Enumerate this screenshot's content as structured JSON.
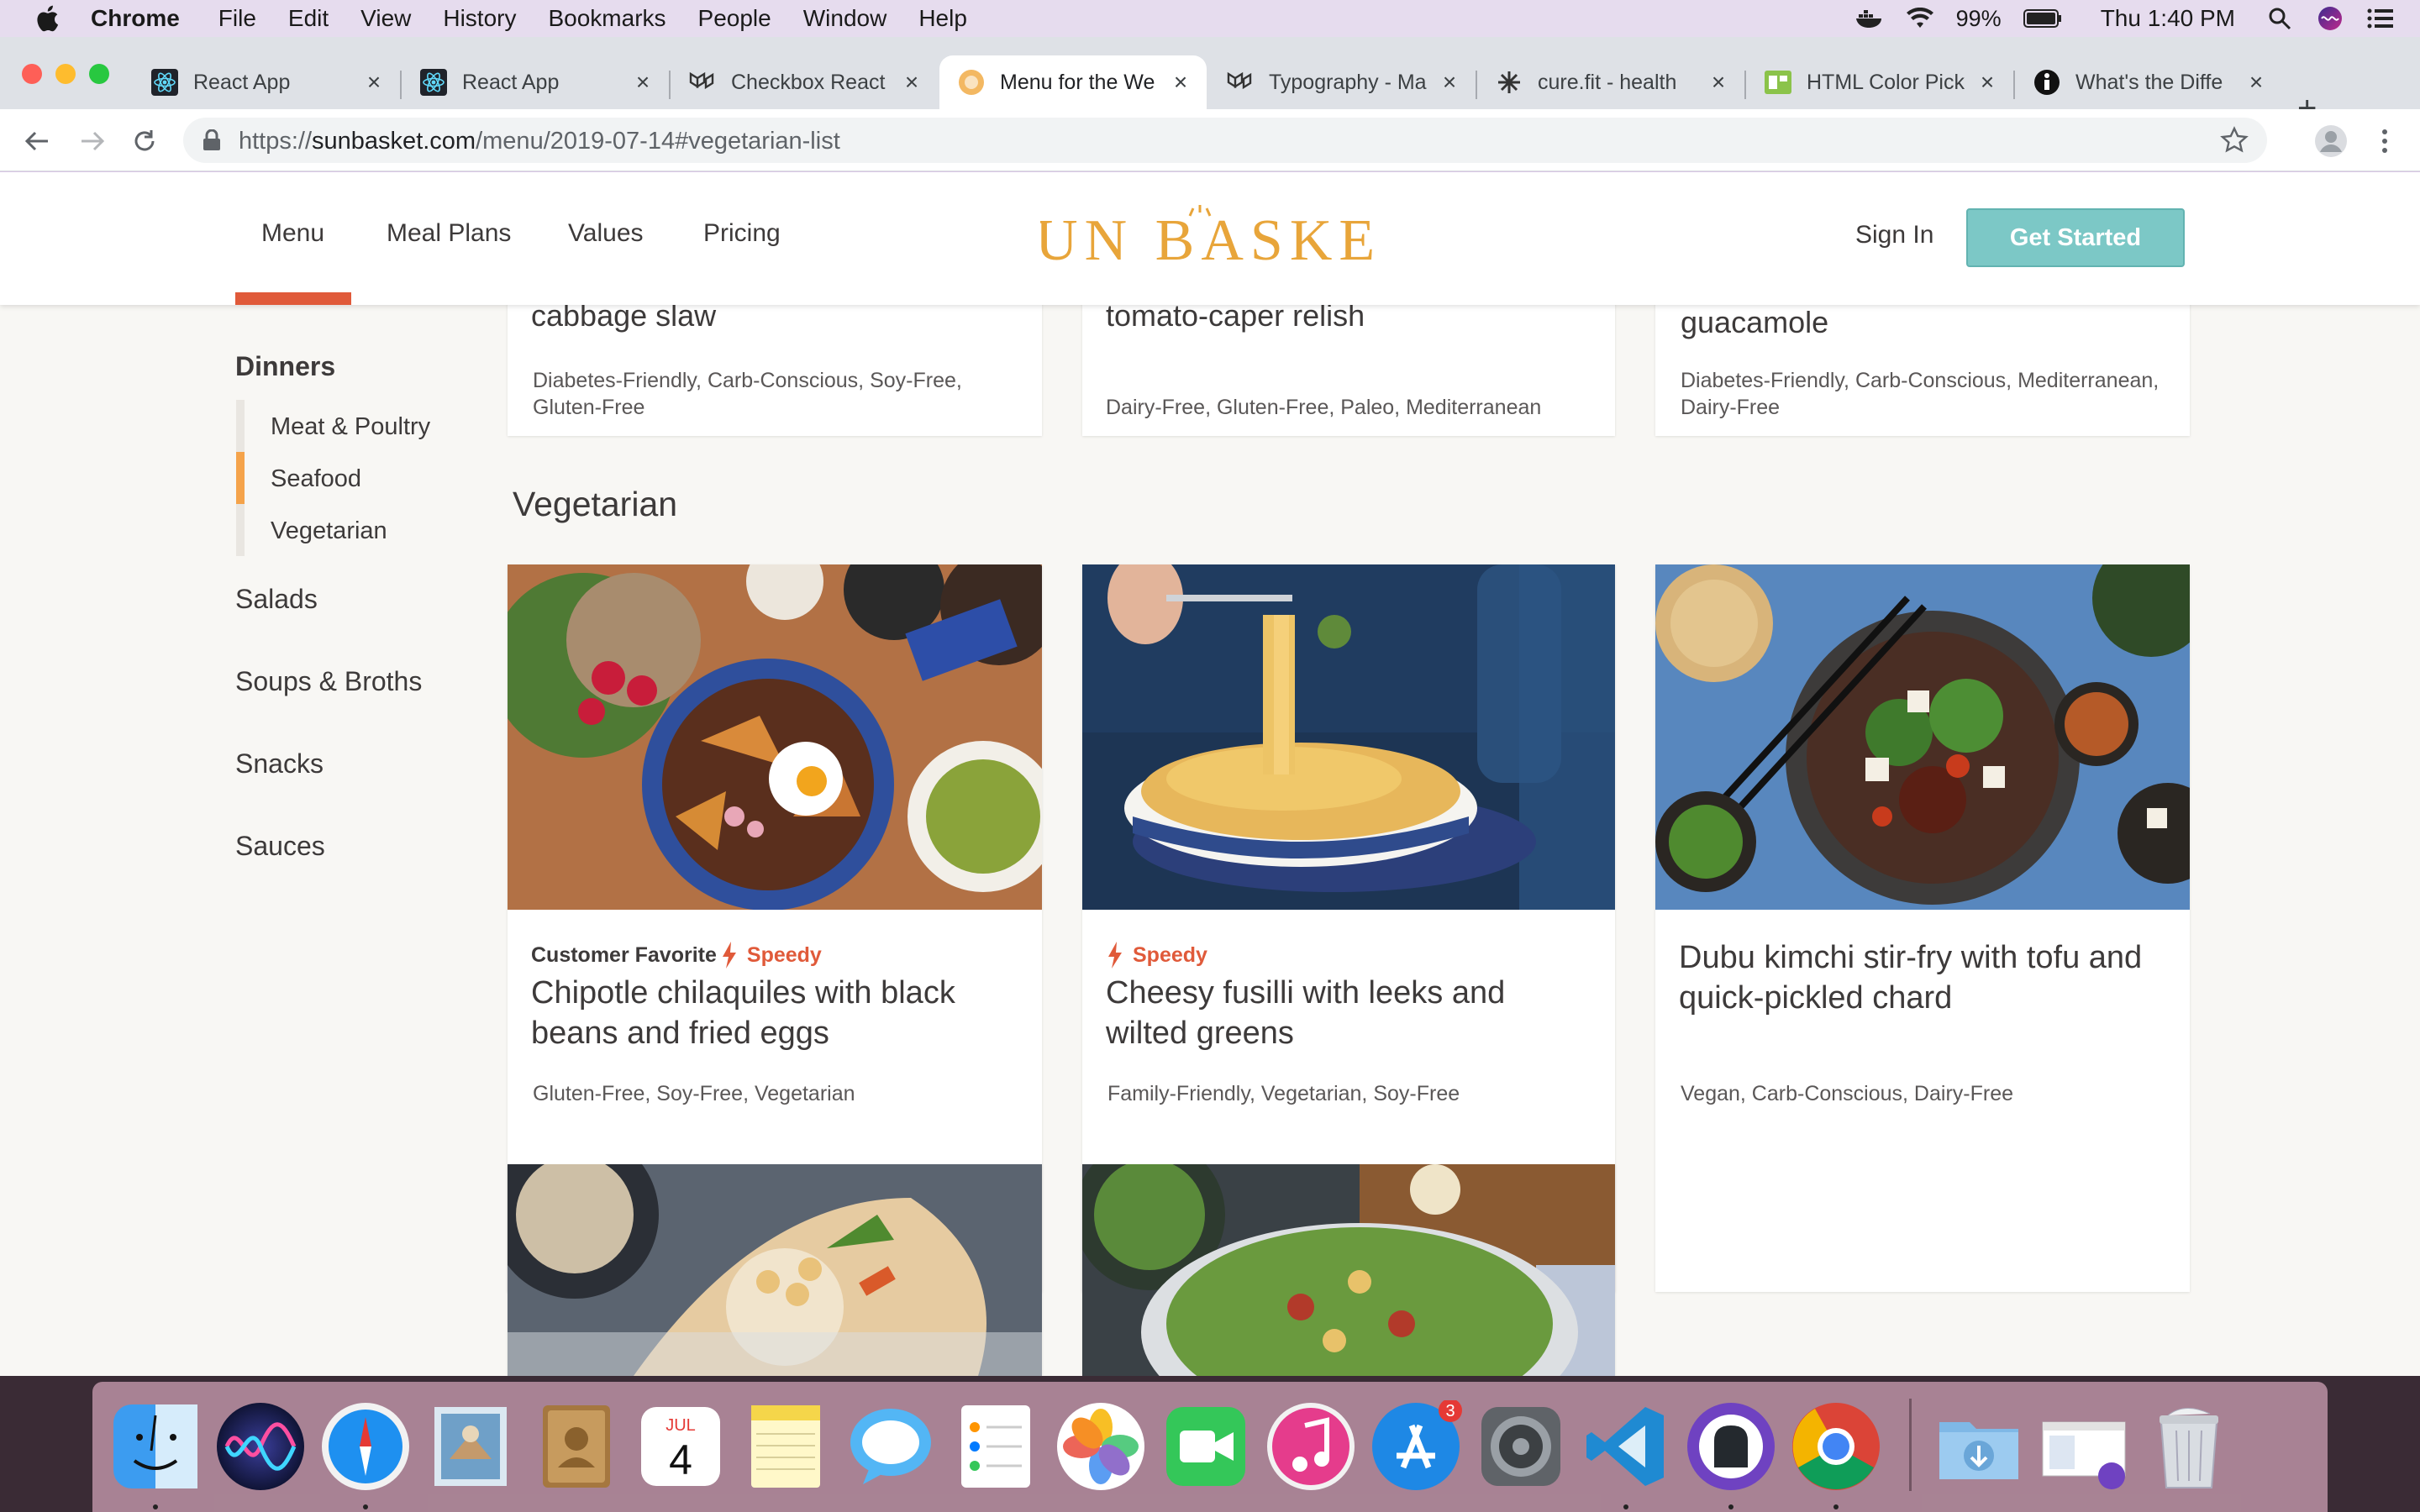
{
  "menubar": {
    "app": "Chrome",
    "items": [
      "File",
      "Edit",
      "View",
      "History",
      "Bookmarks",
      "People",
      "Window",
      "Help"
    ],
    "battery": "99%",
    "clock": "Thu 1:40 PM"
  },
  "tabs": [
    {
      "title": "React App",
      "icon": "react-icon"
    },
    {
      "title": "React App",
      "icon": "react-icon"
    },
    {
      "title": "Checkbox React",
      "icon": "material-ui-icon"
    },
    {
      "title": "Menu for the We",
      "icon": "sunbasket-icon",
      "active": true
    },
    {
      "title": "Typography - Ma",
      "icon": "material-ui-icon"
    },
    {
      "title": "cure.fit - health",
      "icon": "curefit-icon"
    },
    {
      "title": "HTML Color Pick",
      "icon": "color-picker-icon"
    },
    {
      "title": "What's the Diffe",
      "icon": "info-icon"
    }
  ],
  "address": {
    "scheme": "https://",
    "host": "sunbasket.com",
    "path": "/menu/2019-07-14#vegetarian-list"
  },
  "site": {
    "nav": [
      "Menu",
      "Meal Plans",
      "Values",
      "Pricing"
    ],
    "active_nav": "Menu",
    "logo": "SUN BASKET",
    "sign_in": "Sign In",
    "get_started": "Get Started"
  },
  "sidebar": {
    "dinners": "Dinners",
    "dinner_sub": [
      "Meat & Poultry",
      "Seafood",
      "Vegetarian"
    ],
    "active_sub": "Seafood",
    "sections": [
      "Salads",
      "Soups & Broths",
      "Snacks",
      "Sauces"
    ]
  },
  "previous_row": [
    {
      "title_end": "cabbage slaw",
      "tags": "Diabetes-Friendly, Carb-Conscious, Soy-Free,",
      "tags2": "Gluten-Free"
    },
    {
      "title_end": "tomato-caper relish",
      "tags": "Dairy-Free, Gluten-Free, Paleo, Mediterranean",
      "tags2": ""
    },
    {
      "title_end": "guacamole",
      "tags": "Diabetes-Friendly, Carb-Conscious, Mediterranean,",
      "tags2": "Dairy-Free"
    }
  ],
  "vegetarian": {
    "heading": "Vegetarian",
    "cards": [
      {
        "customer_favorite": "Customer Favorite",
        "speedy": "Speedy",
        "title": "Chipotle chilaquiles with black beans and fried eggs",
        "tags": "Gluten-Free, Soy-Free, Vegetarian"
      },
      {
        "speedy": "Speedy",
        "title": "Cheesy fusilli with leeks and wilted greens",
        "tags": "Family-Friendly, Vegetarian, Soy-Free"
      },
      {
        "title": "Dubu kimchi stir-fry with tofu and quick-pickled chard",
        "tags": "Vegan, Carb-Conscious, Dairy-Free"
      }
    ]
  },
  "dock": {
    "items": [
      "finder-icon",
      "siri-icon",
      "safari-icon",
      "mail-icon",
      "contacts-icon",
      "calendar-icon",
      "notes-icon",
      "messages-icon",
      "reminders-icon",
      "photos-icon",
      "facetime-icon",
      "itunes-icon",
      "app-store-icon",
      "system-preferences-icon",
      "vscode-icon",
      "github-desktop-icon",
      "chrome-icon",
      "downloads-folder-icon",
      "screenshot-stack-icon",
      "trash-icon"
    ],
    "calendar_month": "JUL",
    "calendar_day": "4",
    "app_store_badge": "3"
  },
  "colors": {
    "brand_orange": "#e8a53a",
    "accent_red": "#e05a3a",
    "cta_teal": "#7cc8c6",
    "page_bg": "#f8f7f4"
  }
}
